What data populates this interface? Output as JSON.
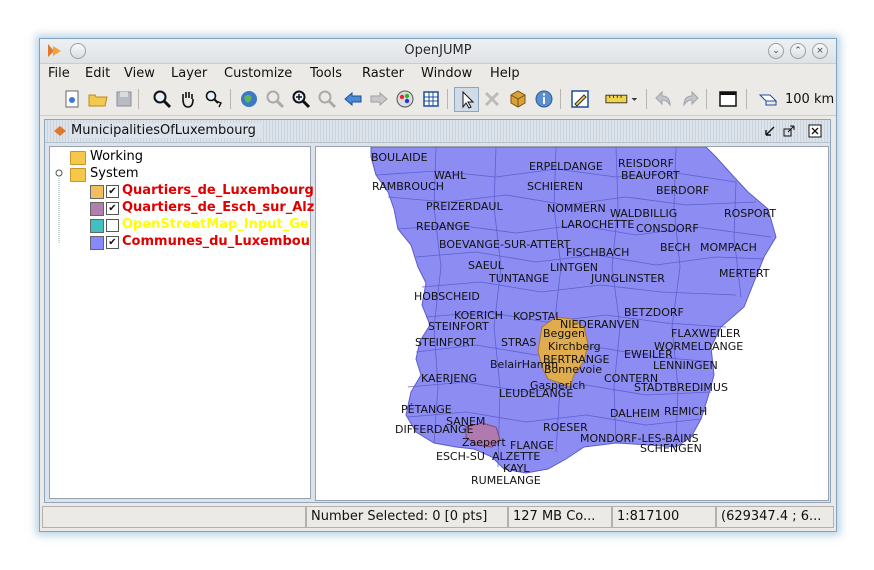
{
  "window": {
    "title": "OpenJUMP"
  },
  "menu": [
    "File",
    "Edit",
    "View",
    "Layer",
    "Customize",
    "Tools",
    "Raster",
    "Window",
    "Help"
  ],
  "toolbar": {
    "scale_label": "100 km",
    "icons": [
      "new-project-icon",
      "open-icon",
      "save-icon",
      "zoom-icon",
      "pan-icon",
      "zoom-realtime-icon",
      "zoom-full-icon",
      "zoom-in-icon",
      "zoom-to-selection-icon",
      "zoom-out-icon",
      "zoom-previous-icon",
      "zoom-next-icon",
      "colour-icon",
      "grid-icon",
      "select-icon",
      "delete-icon",
      "feature-info-icon",
      "info-icon",
      "edit-icon",
      "measure-icon",
      "undo-icon",
      "redo-icon",
      "window-icon",
      "scale-bar-icon"
    ]
  },
  "task_frame": {
    "title": "MunicipalitiesOfLuxembourg"
  },
  "layer_tree": {
    "categories": [
      {
        "name": "Working",
        "layers": []
      },
      {
        "name": "System",
        "layers": [
          {
            "name": "Quartiers_de_Luxembourg",
            "checked": true,
            "color": "#f0c060",
            "label_color": "#e00000"
          },
          {
            "name": "Quartiers_de_Esch_sur_Alz",
            "checked": true,
            "color": "#b080b0",
            "label_color": "#e00000"
          },
          {
            "name": "OpenStreetMap_Input_Ge",
            "checked": false,
            "color": "#40c0c0",
            "label_color": "#ffff00"
          },
          {
            "name": "Communes_du_Luxembou",
            "checked": true,
            "color": "#8888ff",
            "label_color": "#e00000"
          }
        ]
      }
    ]
  },
  "map": {
    "fill_color": "#8c8cf2",
    "city_color": "#e0ac50",
    "esch_color": "#b07ab0",
    "labels": [
      "BOULAIDE",
      "REISDORF",
      "WAHL",
      "ERPELDANGE",
      "BEAUFORT",
      "RAMBROUCH",
      "SCHIEREN",
      "BERDORF",
      "PREIZERDAUL",
      "NOMMERN",
      "WALDBILLIG",
      "ROSPORT",
      "REDANGE",
      "LAROCHETTE",
      "CONSDORF",
      "BOEVANGE-SUR-ATTERT",
      "BECH",
      "MOMPACH",
      "FISCHBACH",
      "LINTGEN",
      "SAEUL",
      "MERTERT",
      "TUNTANGE",
      "JUNGLINSTER",
      "HOBSCHEID",
      "BETZDORF",
      "KOERICH",
      "KOPSTAL",
      "NIEDERANVEN",
      "STEINFORT",
      "Beggen",
      "FLAXWEILER",
      "STEINFORT",
      "STRAS",
      "Kirchberg",
      "WORMELDANGE",
      "EWEILER",
      "BelairHamm",
      "BERTRANGE",
      "LENNINGEN",
      "Bonnevoie",
      "KAERJENG",
      "CONTERN",
      "Gasperich",
      "STADTBREDIMUS",
      "LEUDELANGE",
      "PÉTANGE",
      "DALHEIM",
      "REMICH",
      "SANEM",
      "ROESER",
      "DIFFERDANGE",
      "MONDORF-LES-BAINS",
      "Zaepert",
      "FLANGE",
      "SCHENGEN",
      "ESCH-SU",
      "ALZETTE",
      "KAYL",
      "RUMELANGE"
    ]
  },
  "status": {
    "message": "",
    "selected": "Number Selected: 0 [0 pts]",
    "memory": "127 MB Co...",
    "scale": "1:817100",
    "coords": "(629347.4 ; 6..."
  }
}
